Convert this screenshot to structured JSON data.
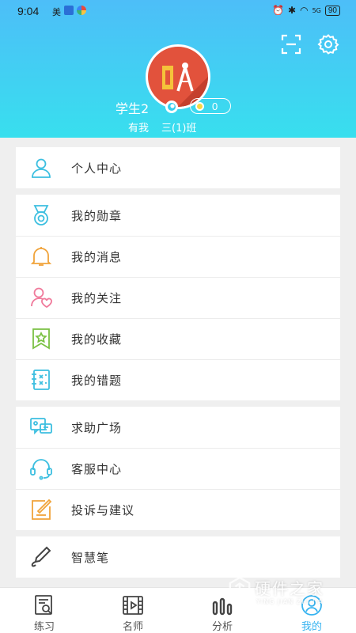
{
  "status_bar": {
    "time": "9:04",
    "carrier_glyph": "美",
    "signal_text": "5G",
    "battery": "90"
  },
  "profile": {
    "username": "学生2",
    "coin_count": "0",
    "school": "有我",
    "class": "三(1)班"
  },
  "menu": {
    "group1": [
      {
        "label": "个人中心",
        "icon": "person-icon",
        "color": "#3cbfe0"
      }
    ],
    "group2": [
      {
        "label": "我的勋章",
        "icon": "medal-icon",
        "color": "#3cbfe0"
      },
      {
        "label": "我的消息",
        "icon": "bell-icon",
        "color": "#f0a33a"
      },
      {
        "label": "我的关注",
        "icon": "follow-icon",
        "color": "#f07a9b"
      },
      {
        "label": "我的收藏",
        "icon": "bookmark-icon",
        "color": "#7ac143"
      },
      {
        "label": "我的错题",
        "icon": "notebook-icon",
        "color": "#3cbfe0"
      }
    ],
    "group3": [
      {
        "label": "求助广场",
        "icon": "chat-icon",
        "color": "#3cbfe0"
      },
      {
        "label": "客服中心",
        "icon": "headset-icon",
        "color": "#3cbfe0"
      },
      {
        "label": "投诉与建议",
        "icon": "edit-icon",
        "color": "#f0a33a"
      }
    ],
    "group4": [
      {
        "label": "智慧笔",
        "icon": "pen-icon",
        "color": "#444444"
      }
    ]
  },
  "bottom_nav": [
    {
      "label": "练习",
      "icon": "practice-icon",
      "active": false
    },
    {
      "label": "名师",
      "icon": "video-icon",
      "active": false
    },
    {
      "label": "分析",
      "icon": "chart-icon",
      "active": false
    },
    {
      "label": "我的",
      "icon": "profile-icon",
      "active": true
    }
  ],
  "watermark": {
    "text": "硬件之家",
    "sub": "YING JIAN ZHI JIA"
  },
  "colors": {
    "header_top": "#4dbef8",
    "header_bottom": "#38dfee",
    "accent": "#37b3f0",
    "avatar_bg": "#e2523c"
  }
}
